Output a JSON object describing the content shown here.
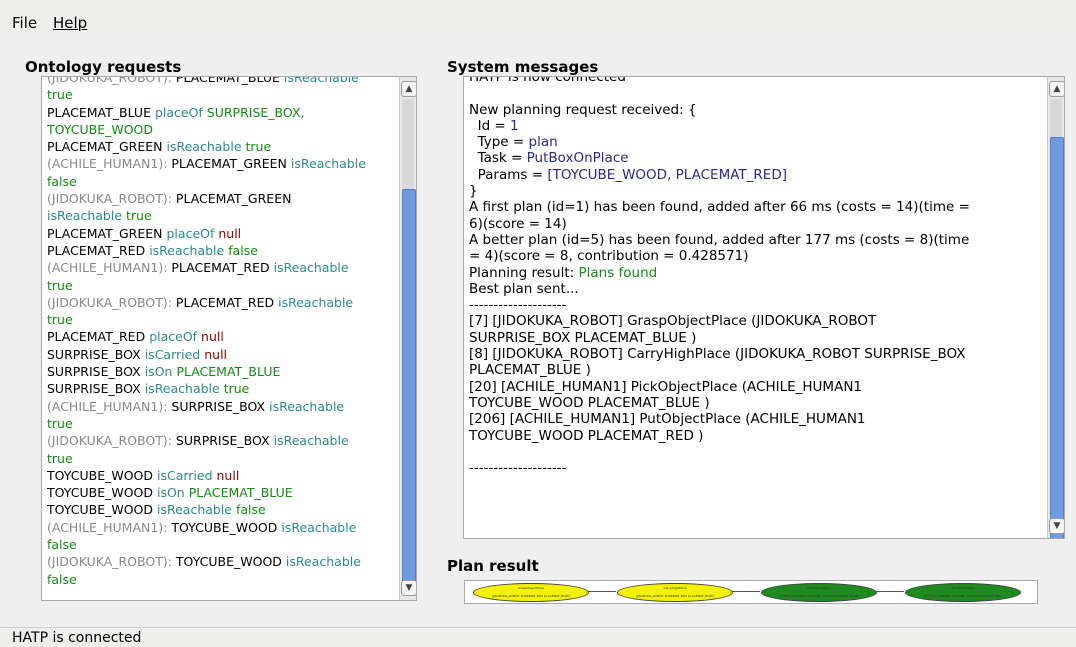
{
  "menu": {
    "file_label": "File",
    "help_label": "Help"
  },
  "ontology": {
    "title": "Ontology requests",
    "lines": [
      [
        {
          "t": "(JIDOKUKA_ROBOT): ",
          "c": "gray"
        },
        {
          "t": "PLACEMAT_BLUE ",
          "c": "black"
        },
        {
          "t": "isReachable",
          "c": "teal"
        }
      ],
      [
        {
          "t": "true",
          "c": "green"
        }
      ],
      [
        {
          "t": "PLACEMAT_BLUE ",
          "c": "black"
        },
        {
          "t": "placeOf ",
          "c": "teal"
        },
        {
          "t": "SURPRISE_BOX,",
          "c": "green"
        }
      ],
      [
        {
          "t": "TOYCUBE_WOOD",
          "c": "green"
        }
      ],
      [
        {
          "t": "PLACEMAT_GREEN ",
          "c": "black"
        },
        {
          "t": "isReachable ",
          "c": "teal"
        },
        {
          "t": "true",
          "c": "green"
        }
      ],
      [
        {
          "t": "(ACHILE_HUMAN1): ",
          "c": "gray"
        },
        {
          "t": "PLACEMAT_GREEN ",
          "c": "black"
        },
        {
          "t": "isReachable",
          "c": "teal"
        }
      ],
      [
        {
          "t": "false",
          "c": "green"
        }
      ],
      [
        {
          "t": "(JIDOKUKA_ROBOT): ",
          "c": "gray"
        },
        {
          "t": "PLACEMAT_GREEN",
          "c": "black"
        }
      ],
      [
        {
          "t": "isReachable ",
          "c": "teal"
        },
        {
          "t": "true",
          "c": "green"
        }
      ],
      [
        {
          "t": "PLACEMAT_GREEN ",
          "c": "black"
        },
        {
          "t": "placeOf ",
          "c": "teal"
        },
        {
          "t": "null",
          "c": "red"
        }
      ],
      [
        {
          "t": "PLACEMAT_RED ",
          "c": "black"
        },
        {
          "t": "isReachable ",
          "c": "teal"
        },
        {
          "t": "false",
          "c": "green"
        }
      ],
      [
        {
          "t": "(ACHILE_HUMAN1): ",
          "c": "gray"
        },
        {
          "t": "PLACEMAT_RED ",
          "c": "black"
        },
        {
          "t": "isReachable",
          "c": "teal"
        }
      ],
      [
        {
          "t": "true",
          "c": "green"
        }
      ],
      [
        {
          "t": "(JIDOKUKA_ROBOT): ",
          "c": "gray"
        },
        {
          "t": "PLACEMAT_RED ",
          "c": "black"
        },
        {
          "t": "isReachable",
          "c": "teal"
        }
      ],
      [
        {
          "t": "true",
          "c": "green"
        }
      ],
      [
        {
          "t": "PLACEMAT_RED ",
          "c": "black"
        },
        {
          "t": "placeOf ",
          "c": "teal"
        },
        {
          "t": "null",
          "c": "red"
        }
      ],
      [
        {
          "t": "SURPRISE_BOX ",
          "c": "black"
        },
        {
          "t": "isCarried ",
          "c": "teal"
        },
        {
          "t": "null",
          "c": "red"
        }
      ],
      [
        {
          "t": "SURPRISE_BOX ",
          "c": "black"
        },
        {
          "t": "isOn ",
          "c": "teal"
        },
        {
          "t": "PLACEMAT_BLUE",
          "c": "green"
        }
      ],
      [
        {
          "t": "SURPRISE_BOX ",
          "c": "black"
        },
        {
          "t": "isReachable ",
          "c": "teal"
        },
        {
          "t": "true",
          "c": "green"
        }
      ],
      [
        {
          "t": "(ACHILE_HUMAN1): ",
          "c": "gray"
        },
        {
          "t": "SURPRISE_BOX ",
          "c": "black"
        },
        {
          "t": "isReachable",
          "c": "teal"
        }
      ],
      [
        {
          "t": "true",
          "c": "green"
        }
      ],
      [
        {
          "t": "(JIDOKUKA_ROBOT): ",
          "c": "gray"
        },
        {
          "t": "SURPRISE_BOX ",
          "c": "black"
        },
        {
          "t": "isReachable",
          "c": "teal"
        }
      ],
      [
        {
          "t": "true",
          "c": "green"
        }
      ],
      [
        {
          "t": "TOYCUBE_WOOD ",
          "c": "black"
        },
        {
          "t": "isCarried ",
          "c": "teal"
        },
        {
          "t": "null",
          "c": "red"
        }
      ],
      [
        {
          "t": "TOYCUBE_WOOD ",
          "c": "black"
        },
        {
          "t": "isOn ",
          "c": "teal"
        },
        {
          "t": "PLACEMAT_BLUE",
          "c": "green"
        }
      ],
      [
        {
          "t": "TOYCUBE_WOOD ",
          "c": "black"
        },
        {
          "t": "isReachable ",
          "c": "teal"
        },
        {
          "t": "false",
          "c": "green"
        }
      ],
      [
        {
          "t": "(ACHILE_HUMAN1): ",
          "c": "gray"
        },
        {
          "t": "TOYCUBE_WOOD ",
          "c": "black"
        },
        {
          "t": "isReachable",
          "c": "teal"
        }
      ],
      [
        {
          "t": "false",
          "c": "green"
        }
      ],
      [
        {
          "t": "(JIDOKUKA_ROBOT): ",
          "c": "gray"
        },
        {
          "t": "TOYCUBE_WOOD ",
          "c": "black"
        },
        {
          "t": "isReachable",
          "c": "teal"
        }
      ],
      [
        {
          "t": "false",
          "c": "green"
        }
      ]
    ]
  },
  "system": {
    "title": "System messages",
    "lines": [
      [
        {
          "t": "HATP is now connected",
          "c": "black"
        }
      ],
      [
        {
          "t": "",
          "c": "black"
        }
      ],
      [
        {
          "t": "New planning request received: {",
          "c": "black"
        }
      ],
      [
        {
          "t": "  Id = ",
          "c": "black"
        },
        {
          "t": "1",
          "c": "navy"
        }
      ],
      [
        {
          "t": "  Type = ",
          "c": "black"
        },
        {
          "t": "plan",
          "c": "navy"
        }
      ],
      [
        {
          "t": "  Task = ",
          "c": "black"
        },
        {
          "t": "PutBoxOnPlace",
          "c": "navy"
        }
      ],
      [
        {
          "t": "  Params = ",
          "c": "black"
        },
        {
          "t": "[TOYCUBE_WOOD, PLACEMAT_RED]",
          "c": "navy"
        }
      ],
      [
        {
          "t": "}",
          "c": "black"
        }
      ],
      [
        {
          "t": "A first plan (id=1) has been found, added after 66 ms (costs = 14)(time =",
          "c": "black"
        }
      ],
      [
        {
          "t": "6)(score = 14)",
          "c": "black"
        }
      ],
      [
        {
          "t": "A better plan (id=5) has been found, added after 177 ms (costs = 8)(time",
          "c": "black"
        }
      ],
      [
        {
          "t": "= 4)(score = 8, contribution = 0.428571)",
          "c": "black"
        }
      ],
      [
        {
          "t": "Planning result: ",
          "c": "black"
        },
        {
          "t": "Plans found",
          "c": "green"
        }
      ],
      [
        {
          "t": "Best plan sent...",
          "c": "black"
        }
      ],
      [
        {
          "t": "--------------------",
          "c": "black"
        }
      ],
      [
        {
          "t": "[7] [JIDOKUKA_ROBOT] GraspObjectPlace (JIDOKUKA_ROBOT",
          "c": "black"
        }
      ],
      [
        {
          "t": "SURPRISE_BOX PLACEMAT_BLUE )",
          "c": "black"
        }
      ],
      [
        {
          "t": "[8] [JIDOKUKA_ROBOT] CarryHighPlace (JIDOKUKA_ROBOT SURPRISE_BOX",
          "c": "black"
        }
      ],
      [
        {
          "t": "PLACEMAT_BLUE )",
          "c": "black"
        }
      ],
      [
        {
          "t": "[20] [ACHILE_HUMAN1] PickObjectPlace (ACHILE_HUMAN1",
          "c": "black"
        }
      ],
      [
        {
          "t": "TOYCUBE_WOOD PLACEMAT_BLUE )",
          "c": "black"
        }
      ],
      [
        {
          "t": "[206] [ACHILE_HUMAN1] PutObjectPlace (ACHILE_HUMAN1",
          "c": "black"
        }
      ],
      [
        {
          "t": "TOYCUBE_WOOD PLACEMAT_RED )",
          "c": "black"
        }
      ],
      [
        {
          "t": "",
          "c": "black"
        }
      ],
      [
        {
          "t": "--------------------",
          "c": "black"
        }
      ]
    ]
  },
  "plan_result": {
    "title": "Plan result",
    "nodes": [
      {
        "label": "GraspObjectPlace",
        "sub": "(JIDOKUKA_ROBOT SURPRISE_BOX PLACEMAT_BLUE)",
        "color": "#f2f200"
      },
      {
        "label": "CarryHighPlace",
        "sub": "(JIDOKUKA_ROBOT SURPRISE_BOX PLACEMAT_BLUE)",
        "color": "#f2f200"
      },
      {
        "label": "PickObjectPlace",
        "sub": "(ACHILE_HUMAN1 TOYCUBE_WOOD PLACEMAT_BLUE)",
        "color": "#1f8a1f"
      },
      {
        "label": "PutObjectPlace",
        "sub": "(ACHILE_HUMAN1 TOYCUBE_WOOD PLACEMAT_RED)",
        "color": "#1f8a1f"
      }
    ]
  },
  "status": {
    "text": "HATP is connected"
  },
  "colors": {
    "gray": "#888888",
    "teal": "#2c8a8a",
    "green": "#138a13",
    "red": "#8b0000",
    "navy": "#2a2a8a",
    "black": "#000000",
    "scroll_thumb": "#6f9be0"
  }
}
